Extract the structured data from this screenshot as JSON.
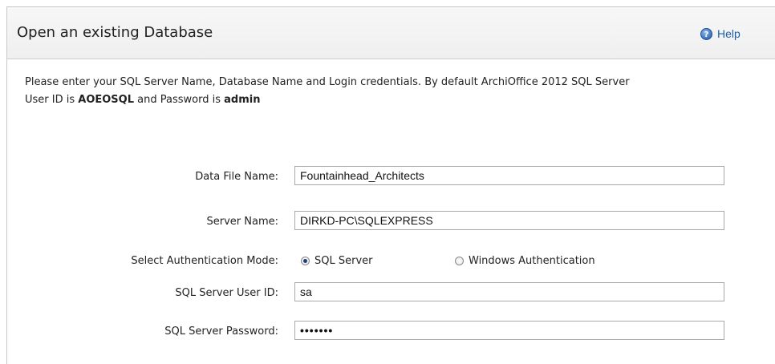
{
  "header": {
    "title": "Open an existing Database",
    "help_label": "Help"
  },
  "intro": {
    "line1": "Please enter your SQL Server Name, Database Name and Login credentials. By default ArchiOffice 2012 SQL Server",
    "line2_prefix": "User ID is ",
    "default_user": "AOEOSQL",
    "line2_middle": " and Password is ",
    "default_password": "admin"
  },
  "form": {
    "data_file_label": "Data File Name:",
    "data_file_value": "Fountainhead_Architects",
    "server_label": "Server Name:",
    "server_value": "DIRKD-PC\\SQLEXPRESS",
    "auth_label": "Select Authentication Mode:",
    "auth_options": [
      {
        "label": "SQL Server",
        "selected": true
      },
      {
        "label": "Windows Authentication",
        "selected": false
      }
    ],
    "user_label": "SQL Server User ID:",
    "user_value": "sa",
    "password_label": "SQL Server Password:",
    "password_masked": "•••••••"
  },
  "colors": {
    "link": "#1c5fa8",
    "header_bg": "#f3f3f3",
    "border": "#a9a9a9"
  },
  "icons": {
    "help": "help-icon"
  }
}
